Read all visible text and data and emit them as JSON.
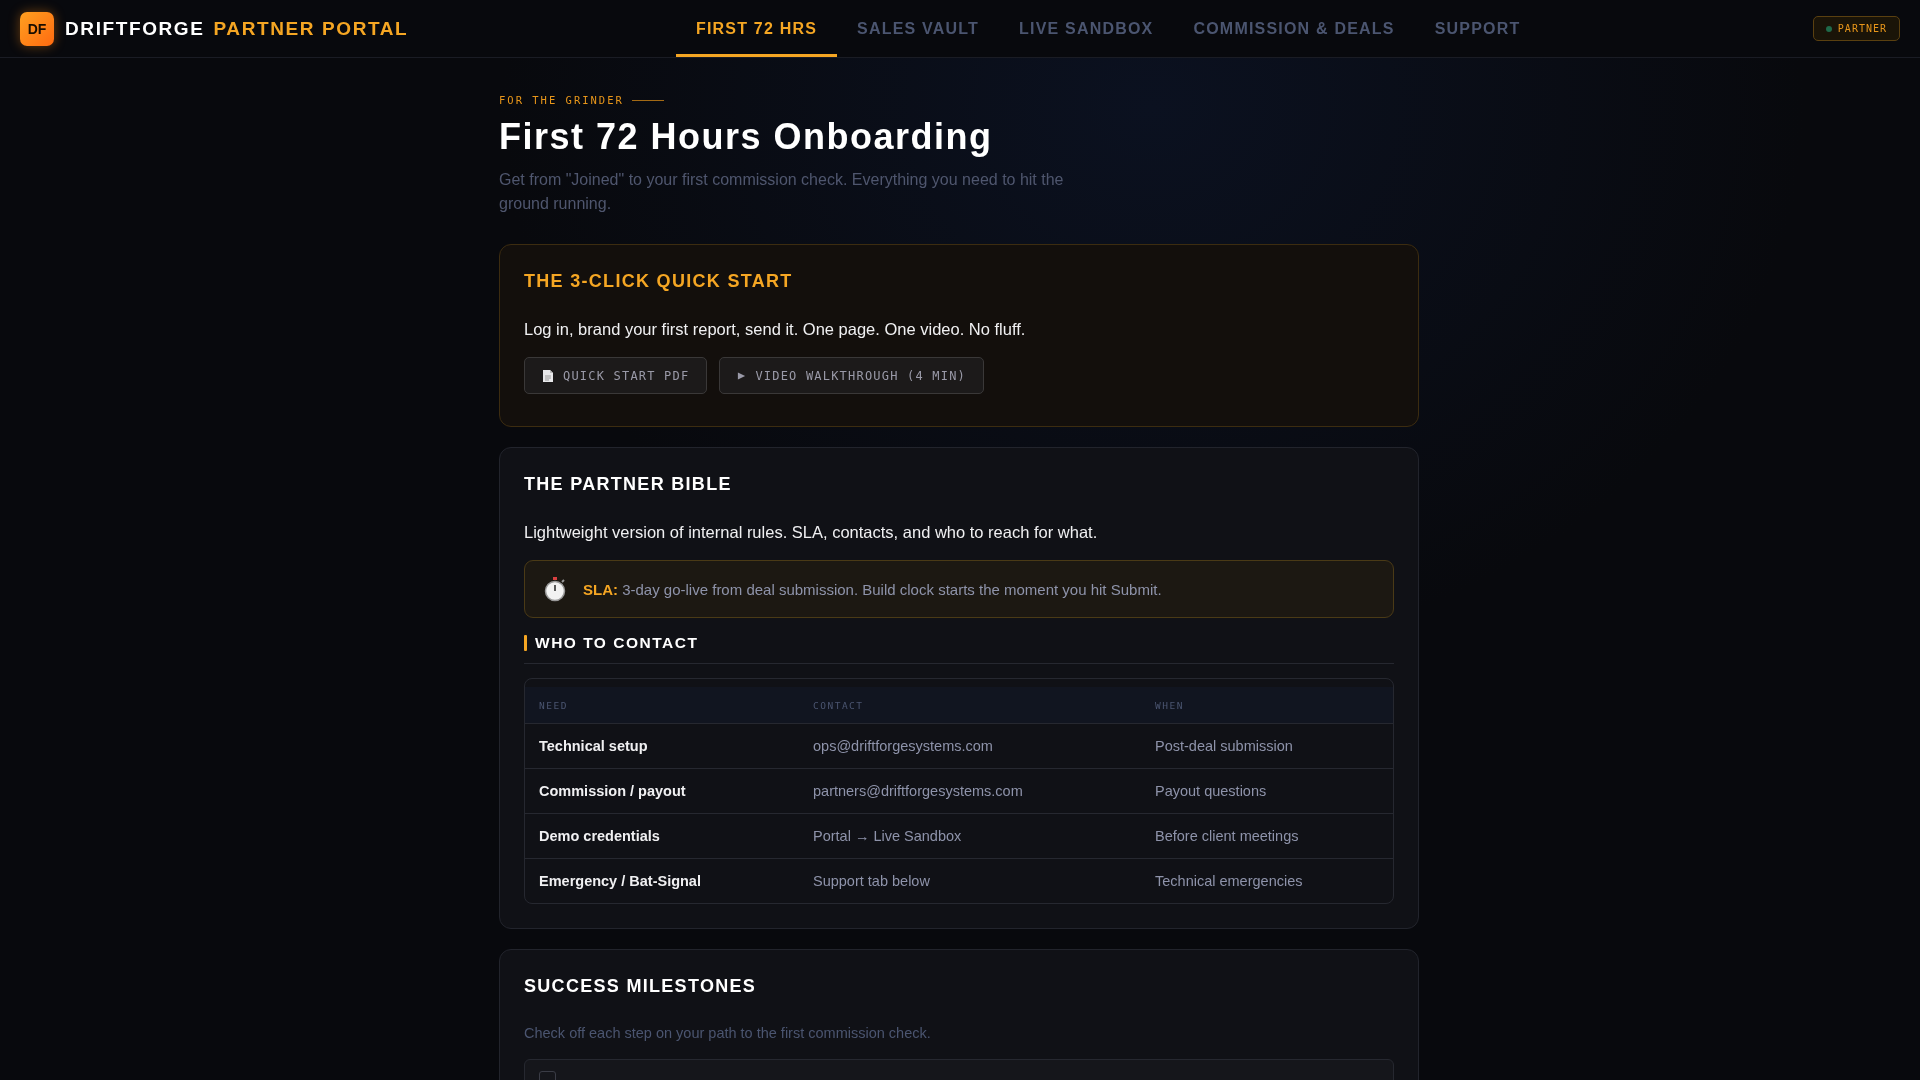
{
  "brand": {
    "logo": "DF",
    "name": "DRIFTFORGE",
    "suffix": "PARTNER PORTAL"
  },
  "nav": [
    {
      "label": "FIRST 72 HRS",
      "selected": true
    },
    {
      "label": "SALES VAULT",
      "selected": false
    },
    {
      "label": "LIVE SANDBOX",
      "selected": false
    },
    {
      "label": "COMMISSION & DEALS",
      "selected": false
    },
    {
      "label": "SUPPORT",
      "selected": false
    }
  ],
  "badge": "PARTNER",
  "eyebrow": "FOR THE GRINDER",
  "title": "First 72 Hours Onboarding",
  "subtitle": "Get from \"Joined\" to your first commission check. Everything you need to hit the ground running.",
  "quick_start": {
    "title": "THE 3-CLICK QUICK START",
    "text": "Log in, brand your first report, send it. One page. One video. No fluff.",
    "buttons": [
      {
        "kind": "pdf",
        "label": "QUICK START PDF"
      },
      {
        "kind": "video",
        "label": "VIDEO WALKTHROUGH (4 MIN)"
      }
    ]
  },
  "bible": {
    "title": "THE PARTNER BIBLE",
    "text": "Lightweight version of internal rules. SLA, contacts, and who to reach for what.",
    "sla": "**SLA:** 3-day go-live from deal submission. Build clock starts the moment you hit Submit.",
    "contact_heading": "WHO TO CONTACT",
    "columns": [
      "NEED",
      "CONTACT",
      "WHEN"
    ],
    "rows": [
      [
        "Technical setup",
        "ops@driftforgesystems.com",
        "Post-deal submission"
      ],
      [
        "Commission / payout",
        "partners@driftforgesystems.com",
        "Payout questions"
      ],
      [
        "Demo credentials",
        "Portal → Live Sandbox",
        "Before client meetings"
      ],
      [
        "Emergency / Bat-Signal",
        "Support tab below",
        "Technical emergencies"
      ]
    ]
  },
  "milestones": {
    "title": "SUCCESS MILESTONES",
    "text": "Check off each step on your path to the first commission check.",
    "items": [
      {
        "checked": false
      }
    ]
  }
}
